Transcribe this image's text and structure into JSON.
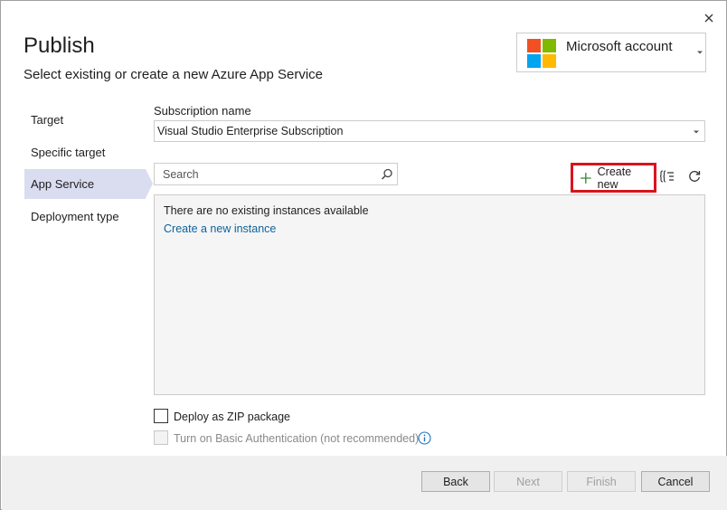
{
  "header": {
    "title": "Publish",
    "subtitle": "Select existing or create a new Azure App Service"
  },
  "account": {
    "label": "Microsoft account",
    "logo_colors": [
      "#f25022",
      "#7fba00",
      "#00a4ef",
      "#ffb900"
    ]
  },
  "nav": {
    "items": [
      {
        "label": "Target",
        "selected": false
      },
      {
        "label": "Specific target",
        "selected": false
      },
      {
        "label": "App Service",
        "selected": true
      },
      {
        "label": "Deployment type",
        "selected": false
      }
    ]
  },
  "subscription": {
    "label": "Subscription name",
    "value": "Visual Studio Enterprise Subscription"
  },
  "search": {
    "placeholder": "Search"
  },
  "toolbar": {
    "create_new_label": "Create new",
    "highlight_color": "#d9141c"
  },
  "instances": {
    "empty_message": "There are no existing instances available",
    "create_link": "Create a new instance"
  },
  "options": {
    "zip_label": "Deploy as ZIP package",
    "zip_checked": false,
    "basic_auth_label": "Turn on Basic Authentication (not recommended)",
    "basic_auth_checked": false,
    "basic_auth_enabled": false
  },
  "footer": {
    "back_label": "Back",
    "next_label": "Next",
    "finish_label": "Finish",
    "cancel_label": "Cancel"
  },
  "colors": {
    "accent_link": "#0e639c",
    "nav_selected": "#dadcf0"
  }
}
